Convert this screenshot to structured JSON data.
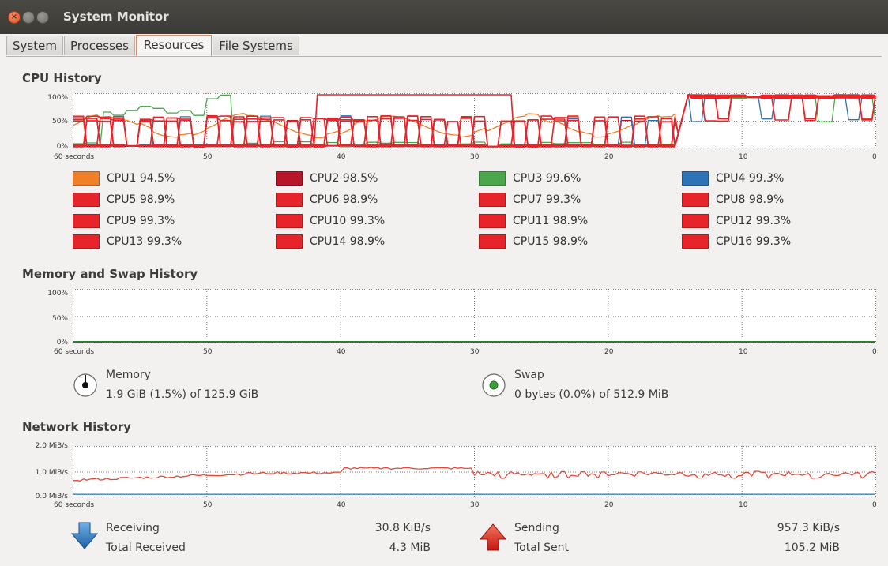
{
  "window": {
    "title": "System Monitor"
  },
  "tabs": [
    {
      "label": "System"
    },
    {
      "label": "Processes"
    },
    {
      "label": "Resources"
    },
    {
      "label": "File Systems"
    }
  ],
  "active_tab": "Resources",
  "cpu": {
    "title": "CPU History",
    "y_labels": [
      "100%",
      "50%",
      "0%"
    ],
    "x_labels": [
      "60 seconds",
      "50",
      "40",
      "30",
      "20",
      "10",
      "0"
    ],
    "legend": [
      {
        "label": "CPU1 94.5%",
        "color": "#f07f2a"
      },
      {
        "label": "CPU2 98.5%",
        "color": "#b8142a"
      },
      {
        "label": "CPU3 99.6%",
        "color": "#4ca64c"
      },
      {
        "label": "CPU4 99.3%",
        "color": "#2f73b7"
      },
      {
        "label": "CPU5 98.9%",
        "color": "#e7242a"
      },
      {
        "label": "CPU6 98.9%",
        "color": "#e7242a"
      },
      {
        "label": "CPU7 99.3%",
        "color": "#e7242a"
      },
      {
        "label": "CPU8 98.9%",
        "color": "#e7242a"
      },
      {
        "label": "CPU9 99.3%",
        "color": "#e7242a"
      },
      {
        "label": "CPU10 99.3%",
        "color": "#e7242a"
      },
      {
        "label": "CPU11 98.9%",
        "color": "#e7242a"
      },
      {
        "label": "CPU12 99.3%",
        "color": "#e7242a"
      },
      {
        "label": "CPU13 99.3%",
        "color": "#e7242a"
      },
      {
        "label": "CPU14 98.9%",
        "color": "#e7242a"
      },
      {
        "label": "CPU15 98.9%",
        "color": "#e7242a"
      },
      {
        "label": "CPU16 99.3%",
        "color": "#e7242a"
      }
    ]
  },
  "memory": {
    "title": "Memory and Swap History",
    "y_labels": [
      "100%",
      "50%",
      "0%"
    ],
    "x_labels": [
      "60 seconds",
      "50",
      "40",
      "30",
      "20",
      "10",
      "0"
    ],
    "memory_label": "Memory",
    "memory_value": "1.9 GiB (1.5%) of 125.9 GiB",
    "swap_label": "Swap",
    "swap_value": "0 bytes (0.0%) of 512.9 MiB"
  },
  "network": {
    "title": "Network History",
    "y_labels": [
      "2.0 MiB/s",
      "1.0 MiB/s",
      "0.0 MiB/s"
    ],
    "x_labels": [
      "60 seconds",
      "50",
      "40",
      "30",
      "20",
      "10",
      "0"
    ],
    "receiving_label": "Receiving",
    "receiving_value": "30.8 KiB/s",
    "total_received_label": "Total Received",
    "total_received_value": "4.3 MiB",
    "sending_label": "Sending",
    "sending_value": "957.3 KiB/s",
    "total_sent_label": "Total Sent",
    "total_sent_value": "105.2 MiB"
  }
}
